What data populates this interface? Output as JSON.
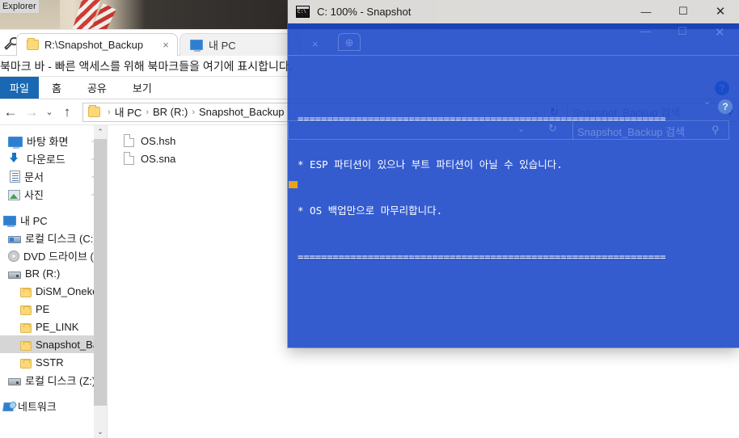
{
  "desktop": {
    "tooltip": "Explorer"
  },
  "explorer": {
    "tabs": [
      {
        "label": "R:\\Snapshot_Backup",
        "icon": "folder-icon",
        "active": true,
        "close": "×"
      },
      {
        "label": "내 PC",
        "icon": "computer-icon",
        "active": false
      }
    ],
    "bookmark_bar": "북마크 바 - 빠른 액세스를 위해 북마크들을 여기에 표시합니다.",
    "ribbon": {
      "tabs": [
        "파일",
        "홈",
        "공유",
        "보기"
      ],
      "active": "파일",
      "help": "?"
    },
    "address": {
      "back": "←",
      "forward": "→",
      "recent": "⌄",
      "up": "↑",
      "crumbs": [
        "내 PC",
        "BR (R:)",
        "Snapshot_Backup"
      ],
      "separator": "›",
      "dropdown": "⌄",
      "refresh": "↻",
      "search_placeholder": "Snapshot_Backup 검색",
      "search_icon": "⚲"
    },
    "navigation": {
      "items": [
        {
          "label": "바탕 화면",
          "icon": "desktop-icon",
          "indent": 1,
          "pinned": true
        },
        {
          "label": "다운로드",
          "icon": "download-icon",
          "indent": 1,
          "pinned": true
        },
        {
          "label": "문서",
          "icon": "documents-icon",
          "indent": 1,
          "pinned": true
        },
        {
          "label": "사진",
          "icon": "pictures-icon",
          "indent": 1,
          "pinned": true
        },
        {
          "label": "내 PC",
          "icon": "computer-icon",
          "indent": 0,
          "pinned": false
        },
        {
          "label": "로컬 디스크 (C:)",
          "icon": "hard-drive-icon",
          "indent": 1,
          "pinned": false
        },
        {
          "label": "DVD 드라이브 (",
          "icon": "dvd-drive-icon",
          "indent": 1,
          "pinned": false
        },
        {
          "label": "BR (R:)",
          "icon": "hard-drive-icon",
          "indent": 1,
          "pinned": false
        },
        {
          "label": "DiSM_Onekey_",
          "icon": "folder-icon",
          "indent": 2,
          "pinned": false
        },
        {
          "label": "PE",
          "icon": "folder-icon",
          "indent": 2,
          "pinned": false
        },
        {
          "label": "PE_LINK",
          "icon": "folder-icon",
          "indent": 2,
          "pinned": false
        },
        {
          "label": "Snapshot_Back",
          "icon": "folder-icon",
          "indent": 2,
          "pinned": false,
          "selected": true
        },
        {
          "label": "SSTR",
          "icon": "folder-icon",
          "indent": 2,
          "pinned": false
        },
        {
          "label": "로컬 디스크 (Z:)",
          "icon": "hard-drive-icon",
          "indent": 1,
          "pinned": false
        },
        {
          "label": "네트워크",
          "icon": "network-icon",
          "indent": 0,
          "pinned": false
        }
      ],
      "scroll_up": "⌃",
      "scroll_down": "⌄"
    },
    "files": [
      {
        "name": "OS.hsh",
        "icon": "file-icon"
      },
      {
        "name": "OS.sna",
        "icon": "file-icon"
      }
    ]
  },
  "console": {
    "title": "C: 100% - Snapshot",
    "icon": "cmd-icon",
    "window_controls": {
      "minimize": "—",
      "maximize": "☐",
      "close": "✕"
    },
    "lines": [
      "===============================================================",
      "* ESP 파티션이 있으나 부트 파티션이 아닐 수 있습니다.",
      "* OS 백업만으로 마무리합니다.",
      "==============================================================="
    ],
    "background_color": "#1846C8",
    "text_color": "#ffffff",
    "cursor_color": "#e8a317"
  }
}
